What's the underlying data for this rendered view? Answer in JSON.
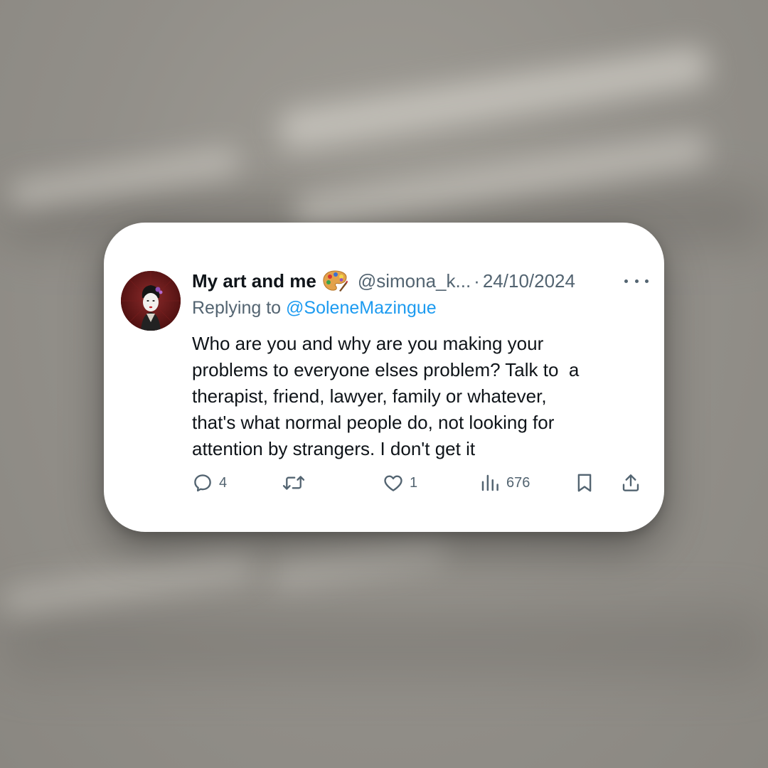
{
  "tweet": {
    "display_name": "My art and me",
    "name_emoji": "palette-emoji",
    "handle": "@simona_k...",
    "separator": "·",
    "date": "24/10/2024",
    "replying_to_label": "Replying to",
    "replying_to_handle": "@SoleneMazingue",
    "text_lines": [
      "Who are you and why are you making your",
      "problems to everyone elses problem? Talk to  a",
      "therapist, friend, lawyer, family or whatever,",
      "that's what normal people do, not looking for",
      "attention by strangers. I don't get it"
    ],
    "actions": {
      "replies": {
        "icon": "reply-icon",
        "count": "4"
      },
      "reposts": {
        "icon": "repost-icon",
        "count": ""
      },
      "likes": {
        "icon": "heart-icon",
        "count": "1"
      },
      "views": {
        "icon": "views-icon",
        "count": "676"
      },
      "bookmark": {
        "icon": "bookmark-icon"
      },
      "share": {
        "icon": "share-icon"
      }
    },
    "more_icon": "more-icon"
  },
  "colors": {
    "text_primary": "#0f1419",
    "text_secondary": "#536471",
    "link": "#1d9bf0",
    "card_bg": "#ffffff",
    "backdrop": "#8e8b85"
  }
}
